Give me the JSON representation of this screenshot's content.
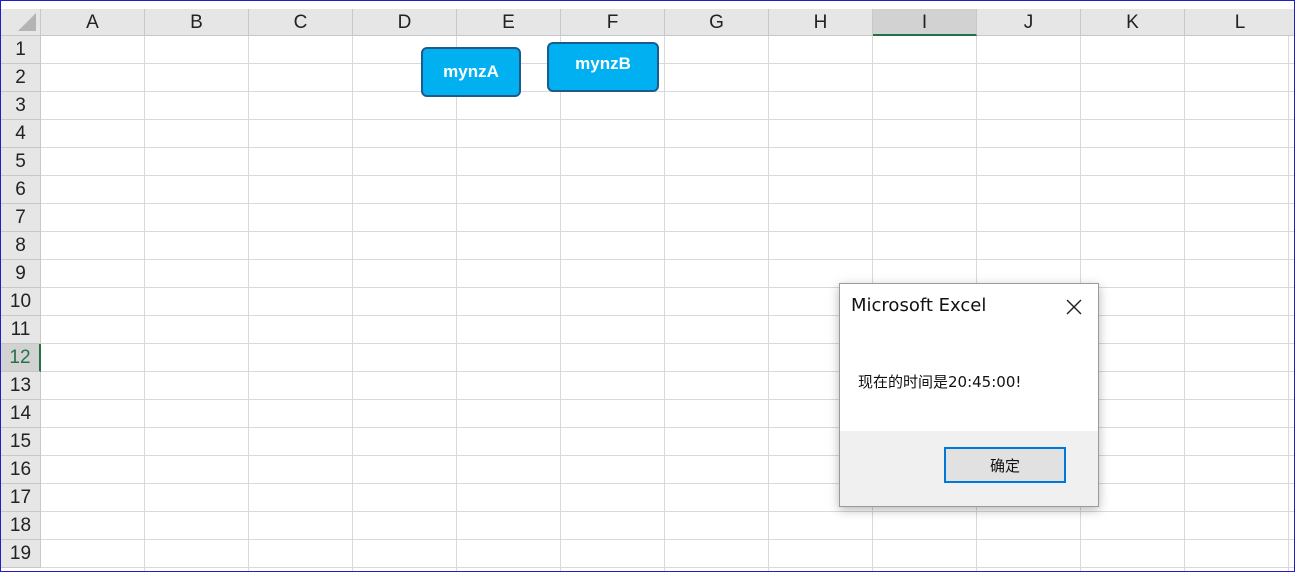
{
  "spreadsheet": {
    "columns": [
      "A",
      "B",
      "C",
      "D",
      "E",
      "F",
      "G",
      "H",
      "I",
      "J",
      "K",
      "L"
    ],
    "rows": [
      "1",
      "2",
      "3",
      "4",
      "5",
      "6",
      "7",
      "8",
      "9",
      "10",
      "11",
      "12",
      "13",
      "14",
      "15",
      "16",
      "17",
      "18",
      "19"
    ],
    "selected_column": "I",
    "selected_row": "12"
  },
  "shapes": {
    "button_a_label": "mynzA",
    "button_b_label": "mynzB",
    "fill_color": "#00b0f0"
  },
  "dialog": {
    "title": "Microsoft Excel",
    "message": "现在的时间是20:45:00!",
    "ok_label": "确定",
    "close_icon": "close-icon"
  },
  "colors": {
    "accent": "#217346",
    "focus": "#0078d7"
  }
}
